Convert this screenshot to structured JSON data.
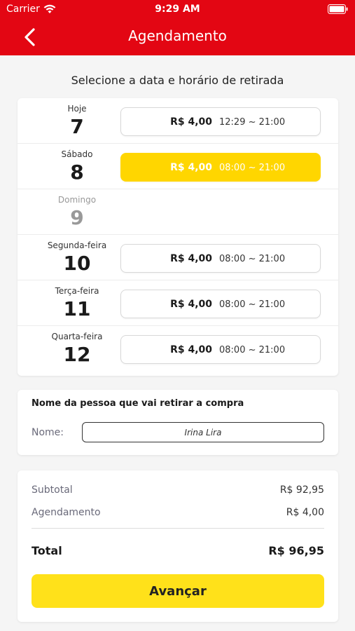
{
  "status_bar": {
    "carrier": "Carrier",
    "time": "9:29 AM"
  },
  "nav": {
    "title": "Agendamento",
    "back_icon": "chevron-left-icon"
  },
  "section_heading": "Selecione a data e horário de retirada",
  "dates": [
    {
      "label": "Hoje",
      "day": "7",
      "price": "R$ 4,00",
      "hours": "12:29 ~ 21:00",
      "selected": false,
      "disabled": false
    },
    {
      "label": "Sábado",
      "day": "8",
      "price": "R$ 4,00",
      "hours": "08:00 ~ 21:00",
      "selected": true,
      "disabled": false
    },
    {
      "label": "Domingo",
      "day": "9",
      "price": "",
      "hours": "",
      "selected": false,
      "disabled": true
    },
    {
      "label": "Segunda-feira",
      "day": "10",
      "price": "R$ 4,00",
      "hours": "08:00 ~ 21:00",
      "selected": false,
      "disabled": false
    },
    {
      "label": "Terça-feira",
      "day": "11",
      "price": "R$ 4,00",
      "hours": "08:00 ~ 21:00",
      "selected": false,
      "disabled": false
    },
    {
      "label": "Quarta-feira",
      "day": "12",
      "price": "R$ 4,00",
      "hours": "08:00 ~ 21:00",
      "selected": false,
      "disabled": false
    }
  ],
  "pickup": {
    "title": "Nome da pessoa que vai retirar a compra",
    "name_label": "Nome:",
    "name_value": "Irina Lira"
  },
  "summary": {
    "subtotal_label": "Subtotal",
    "subtotal_value": "R$ 92,95",
    "scheduling_label": "Agendamento",
    "scheduling_value": "R$ 4,00",
    "total_label": "Total",
    "total_value": "R$ 96,95",
    "advance_button": "Avançar"
  },
  "colors": {
    "header_red": "#e30613",
    "accent_yellow": "#ffd600",
    "button_yellow": "#ffe11a"
  }
}
